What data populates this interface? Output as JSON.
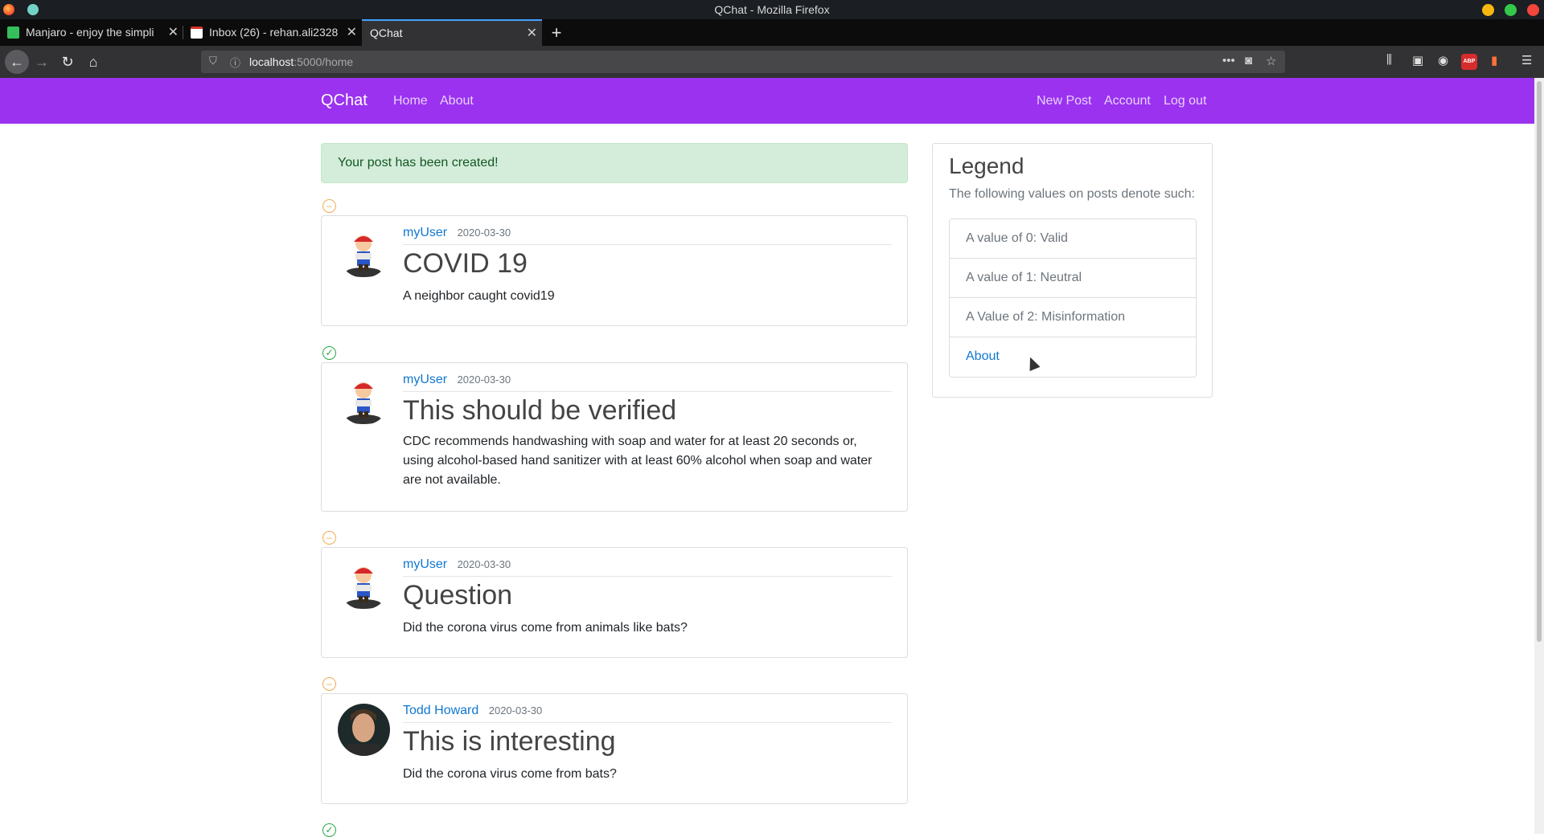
{
  "window": {
    "title": "QChat - Mozilla Firefox"
  },
  "browser": {
    "tabs": [
      {
        "label": "Manjaro - enjoy the simpli",
        "favicon_color": "#35bf5c"
      },
      {
        "label": "Inbox (26) - rehan.ali2328",
        "favicon_color": "#d93025"
      },
      {
        "label": "QChat",
        "favicon_color": ""
      }
    ],
    "url_host": "localhost",
    "url_path": ":5000/home"
  },
  "site": {
    "brand": "QChat",
    "nav_left": [
      "Home",
      "About"
    ],
    "nav_right": [
      "New Post",
      "Account",
      "Log out"
    ],
    "nav_color": "#9a32f0"
  },
  "alert": {
    "message": "Your post has been created!"
  },
  "posts": [
    {
      "status": "neutral",
      "status_icon": "minus-circle-icon",
      "author": "myUser",
      "date": "2020-03-30",
      "title": "COVID 19",
      "content": "A neighbor caught covid19",
      "avatar": "mario-avatar"
    },
    {
      "status": "valid",
      "status_icon": "check-circle-icon",
      "author": "myUser",
      "date": "2020-03-30",
      "title": "This should be verified",
      "content": "CDC recommends handwashing with soap and water for at least 20 seconds or, using alcohol-based hand sanitizer with at least 60% alcohol when soap and water are not available.",
      "avatar": "mario-avatar"
    },
    {
      "status": "neutral",
      "status_icon": "minus-circle-icon",
      "author": "myUser",
      "date": "2020-03-30",
      "title": "Question",
      "content": "Did the corona virus come from animals like bats?",
      "avatar": "mario-avatar"
    },
    {
      "status": "neutral",
      "status_icon": "minus-circle-icon",
      "author": "Todd Howard",
      "date": "2020-03-30",
      "title": "This is interesting",
      "content": "Did the corona virus come from bats?",
      "avatar": "person-avatar"
    }
  ],
  "legend": {
    "title": "Legend",
    "subtitle": "The following values on posts denote such:",
    "items": [
      "A value of 0: Valid",
      "A value of 1: Neutral",
      "A Value of 2: Misinformation",
      "About"
    ]
  }
}
